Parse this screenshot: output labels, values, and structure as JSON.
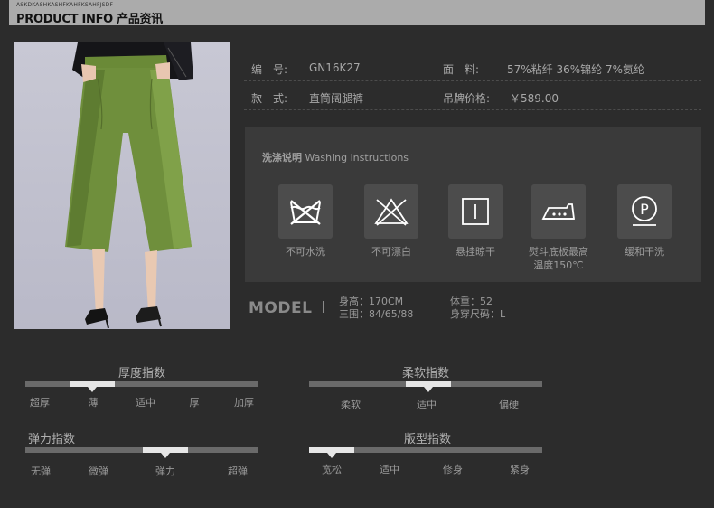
{
  "header": {
    "small_text": "ASKDKASHKASHFKAHFKSAHFJSDF",
    "title": "PRODUCT INFO 产品资讯"
  },
  "product_info": {
    "code_label": "编　号:",
    "code_value": "GN16K27",
    "fabric_label": "面　料:",
    "fabric_value": "57%粘纤  36%锦纶  7%氨纶",
    "style_label": "款　式:",
    "style_value": "直筒阔腿裤",
    "price_label": "吊牌价格:",
    "price_value": "￥589.00"
  },
  "washing": {
    "title_cn": "洗涤说明",
    "title_en": "Washing instructions",
    "items": [
      {
        "icon": "no-wash-icon",
        "label": "不可水洗"
      },
      {
        "icon": "no-bleach-icon",
        "label": "不可漂白"
      },
      {
        "icon": "hang-dry-icon",
        "label": "悬挂晾干"
      },
      {
        "icon": "iron-icon",
        "label": "熨斗底板最高温度150℃"
      },
      {
        "icon": "gentle-dry-clean-icon",
        "label": "缓和干洗"
      }
    ],
    "iron_label_line1": "熨斗底板最高",
    "iron_label_line2": "温度150℃"
  },
  "model": {
    "word": "MODEL",
    "height": "身高：170CM",
    "measurements": "三围：84/65/88",
    "weight": "体重：52",
    "size": "身穿尺码：L"
  },
  "scales": {
    "thickness": {
      "title": "厚度指数",
      "ticks": [
        "超厚",
        "薄",
        "适中",
        "厚",
        "加厚"
      ],
      "selected": "薄"
    },
    "softness": {
      "title": "柔软指数",
      "ticks": [
        "柔软",
        "适中",
        "偏硬"
      ],
      "selected": "适中"
    },
    "elasticity": {
      "title": "弹力指数",
      "ticks": [
        "无弹",
        "微弹",
        "弹力",
        "超弹"
      ],
      "selected": "弹力"
    },
    "fit": {
      "title": "版型指数",
      "ticks": [
        "宽松",
        "适中",
        "修身",
        "紧身"
      ],
      "selected": "宽松"
    }
  },
  "colors": {
    "background": "#2c2c2c",
    "header_bar": "#ababab",
    "pants_green": "#6f8f3c",
    "scale_highlight": "#e6e6e6"
  }
}
